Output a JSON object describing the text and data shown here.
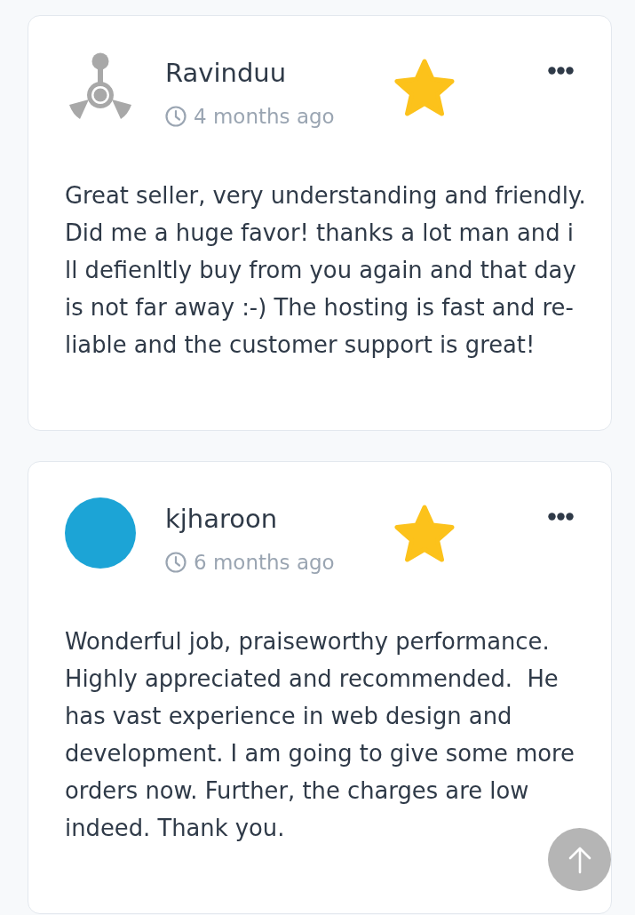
{
  "reviews": [
    {
      "avatar": {
        "kind": "icon"
      },
      "name": "Ravinduu",
      "time": "4 months ago",
      "starred": true,
      "text": "Great seller, very understanding and friendly. Did me a huge favor! thanks a lot man and i ll defienltly buy from you again and that day is not far away :-) The hosting is fast and re-liable and the customer support is great!"
    },
    {
      "avatar": {
        "kind": "photo"
      },
      "name": "kjharoon",
      "time": "6 months ago",
      "starred": true,
      "text": "Wonderful job, praiseworthy performance. Highly appreciated and recommended.  He has vast experience in web design and development. I am going to give some more orders now. Further, the charges are low indeed. Thank you."
    }
  ]
}
